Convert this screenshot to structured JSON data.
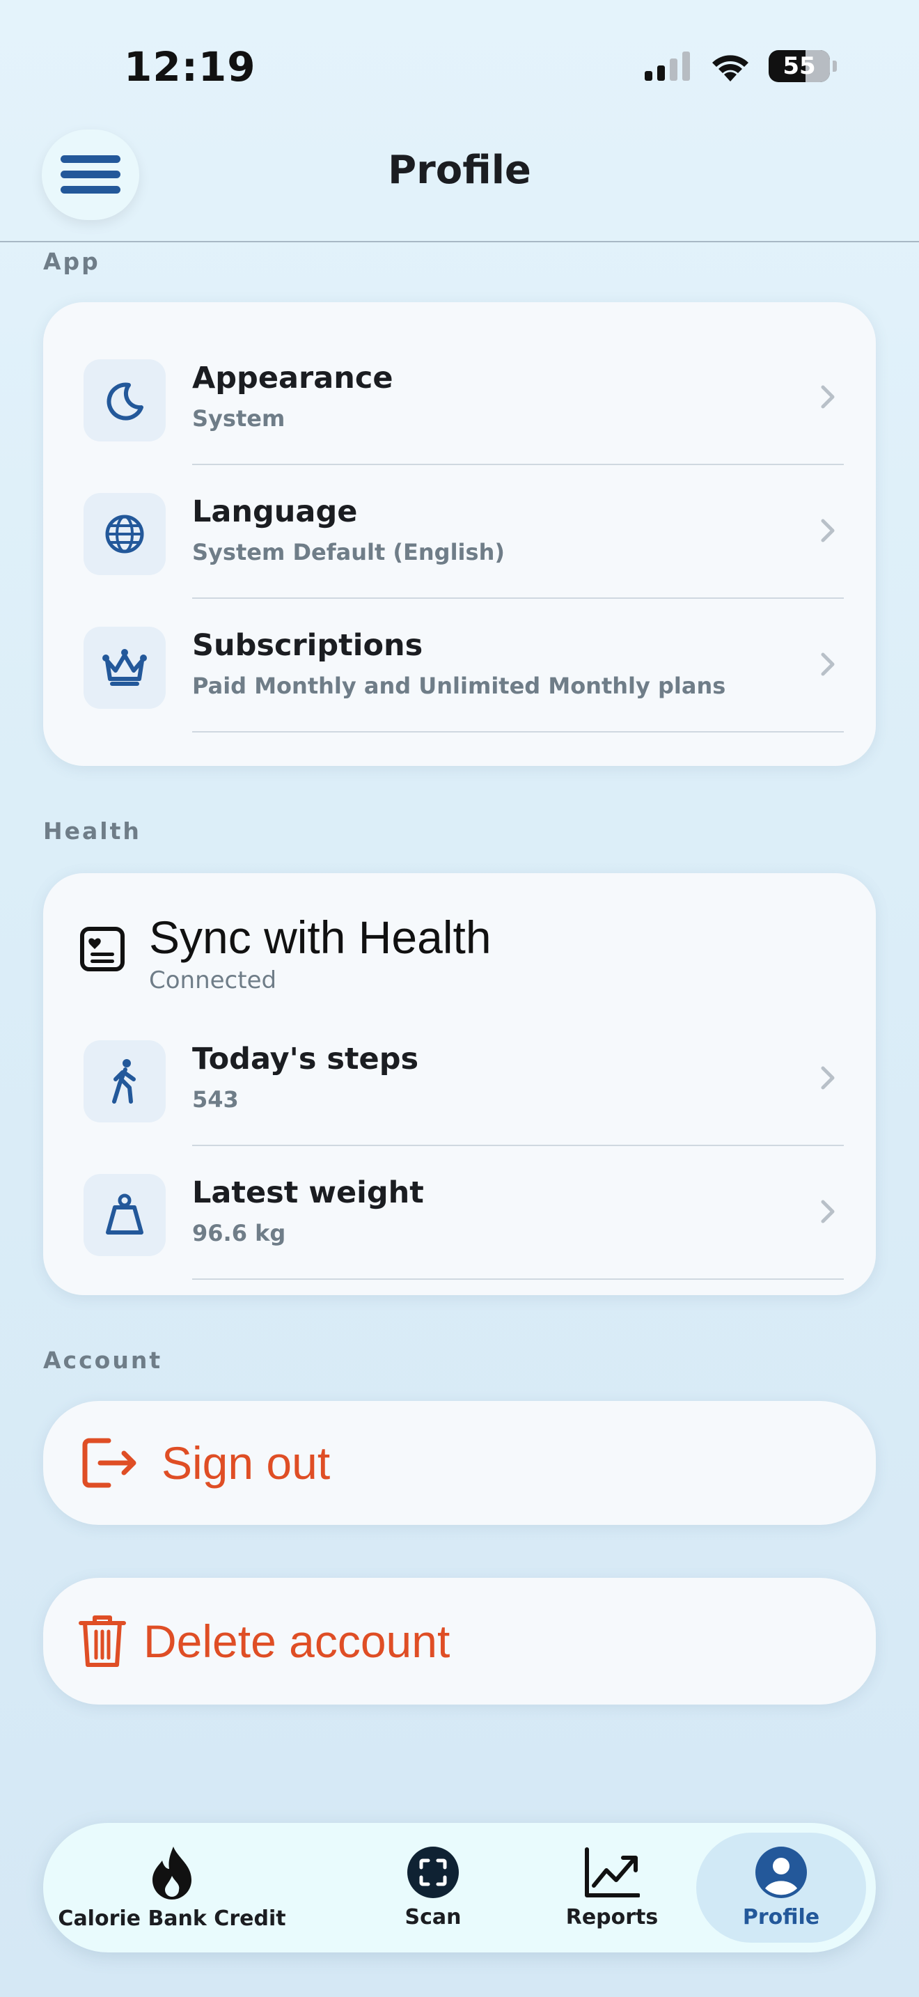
{
  "status_bar": {
    "time": "12:19",
    "battery": "55"
  },
  "header": {
    "title": "Profile"
  },
  "sections": {
    "app": {
      "label": "App",
      "rows": [
        {
          "title": "Appearance",
          "subtitle": "System",
          "icon": "moon-icon"
        },
        {
          "title": "Language",
          "subtitle": "System Default (English)",
          "icon": "globe-icon"
        },
        {
          "title": "Subscriptions",
          "subtitle": "Paid Monthly and Unlimited Monthly plans",
          "icon": "crown-icon"
        }
      ]
    },
    "health": {
      "label": "Health",
      "sync_title": "Sync with Health",
      "sync_status": "Connected",
      "rows": [
        {
          "title": "Today's steps",
          "subtitle": "543",
          "icon": "walking-icon"
        },
        {
          "title": "Latest weight",
          "subtitle": "96.6 kg",
          "icon": "weight-icon"
        }
      ]
    },
    "account": {
      "label": "Account",
      "sign_out": "Sign out",
      "delete_account": "Delete account"
    }
  },
  "tabs": [
    {
      "label": "Calorie Bank Credit",
      "icon": "flame-icon"
    },
    {
      "label": "Scan",
      "icon": "scan-icon"
    },
    {
      "label": "Reports",
      "icon": "chart-icon"
    },
    {
      "label": "Profile",
      "icon": "profile-icon",
      "active": true
    }
  ],
  "colors": {
    "accent": "#23589a",
    "destructive": "#df4e25",
    "background": "#dceef8"
  }
}
